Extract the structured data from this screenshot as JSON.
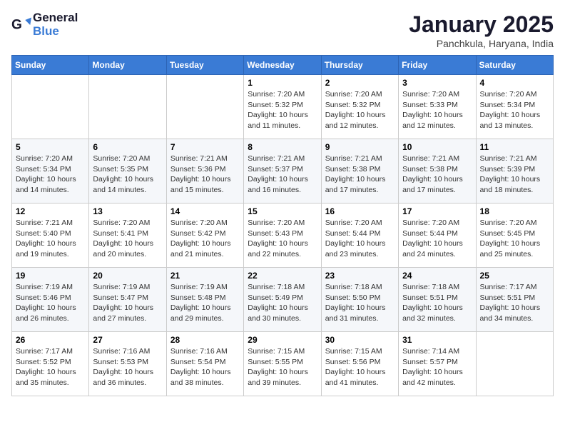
{
  "header": {
    "logo_line1": "General",
    "logo_line2": "Blue",
    "month": "January 2025",
    "location": "Panchkula, Haryana, India"
  },
  "days_of_week": [
    "Sunday",
    "Monday",
    "Tuesday",
    "Wednesday",
    "Thursday",
    "Friday",
    "Saturday"
  ],
  "weeks": [
    [
      {
        "day": "",
        "info": ""
      },
      {
        "day": "",
        "info": ""
      },
      {
        "day": "",
        "info": ""
      },
      {
        "day": "1",
        "info": "Sunrise: 7:20 AM\nSunset: 5:32 PM\nDaylight: 10 hours\nand 11 minutes."
      },
      {
        "day": "2",
        "info": "Sunrise: 7:20 AM\nSunset: 5:32 PM\nDaylight: 10 hours\nand 12 minutes."
      },
      {
        "day": "3",
        "info": "Sunrise: 7:20 AM\nSunset: 5:33 PM\nDaylight: 10 hours\nand 12 minutes."
      },
      {
        "day": "4",
        "info": "Sunrise: 7:20 AM\nSunset: 5:34 PM\nDaylight: 10 hours\nand 13 minutes."
      }
    ],
    [
      {
        "day": "5",
        "info": "Sunrise: 7:20 AM\nSunset: 5:34 PM\nDaylight: 10 hours\nand 14 minutes."
      },
      {
        "day": "6",
        "info": "Sunrise: 7:20 AM\nSunset: 5:35 PM\nDaylight: 10 hours\nand 14 minutes."
      },
      {
        "day": "7",
        "info": "Sunrise: 7:21 AM\nSunset: 5:36 PM\nDaylight: 10 hours\nand 15 minutes."
      },
      {
        "day": "8",
        "info": "Sunrise: 7:21 AM\nSunset: 5:37 PM\nDaylight: 10 hours\nand 16 minutes."
      },
      {
        "day": "9",
        "info": "Sunrise: 7:21 AM\nSunset: 5:38 PM\nDaylight: 10 hours\nand 17 minutes."
      },
      {
        "day": "10",
        "info": "Sunrise: 7:21 AM\nSunset: 5:38 PM\nDaylight: 10 hours\nand 17 minutes."
      },
      {
        "day": "11",
        "info": "Sunrise: 7:21 AM\nSunset: 5:39 PM\nDaylight: 10 hours\nand 18 minutes."
      }
    ],
    [
      {
        "day": "12",
        "info": "Sunrise: 7:21 AM\nSunset: 5:40 PM\nDaylight: 10 hours\nand 19 minutes."
      },
      {
        "day": "13",
        "info": "Sunrise: 7:20 AM\nSunset: 5:41 PM\nDaylight: 10 hours\nand 20 minutes."
      },
      {
        "day": "14",
        "info": "Sunrise: 7:20 AM\nSunset: 5:42 PM\nDaylight: 10 hours\nand 21 minutes."
      },
      {
        "day": "15",
        "info": "Sunrise: 7:20 AM\nSunset: 5:43 PM\nDaylight: 10 hours\nand 22 minutes."
      },
      {
        "day": "16",
        "info": "Sunrise: 7:20 AM\nSunset: 5:44 PM\nDaylight: 10 hours\nand 23 minutes."
      },
      {
        "day": "17",
        "info": "Sunrise: 7:20 AM\nSunset: 5:44 PM\nDaylight: 10 hours\nand 24 minutes."
      },
      {
        "day": "18",
        "info": "Sunrise: 7:20 AM\nSunset: 5:45 PM\nDaylight: 10 hours\nand 25 minutes."
      }
    ],
    [
      {
        "day": "19",
        "info": "Sunrise: 7:19 AM\nSunset: 5:46 PM\nDaylight: 10 hours\nand 26 minutes."
      },
      {
        "day": "20",
        "info": "Sunrise: 7:19 AM\nSunset: 5:47 PM\nDaylight: 10 hours\nand 27 minutes."
      },
      {
        "day": "21",
        "info": "Sunrise: 7:19 AM\nSunset: 5:48 PM\nDaylight: 10 hours\nand 29 minutes."
      },
      {
        "day": "22",
        "info": "Sunrise: 7:18 AM\nSunset: 5:49 PM\nDaylight: 10 hours\nand 30 minutes."
      },
      {
        "day": "23",
        "info": "Sunrise: 7:18 AM\nSunset: 5:50 PM\nDaylight: 10 hours\nand 31 minutes."
      },
      {
        "day": "24",
        "info": "Sunrise: 7:18 AM\nSunset: 5:51 PM\nDaylight: 10 hours\nand 32 minutes."
      },
      {
        "day": "25",
        "info": "Sunrise: 7:17 AM\nSunset: 5:51 PM\nDaylight: 10 hours\nand 34 minutes."
      }
    ],
    [
      {
        "day": "26",
        "info": "Sunrise: 7:17 AM\nSunset: 5:52 PM\nDaylight: 10 hours\nand 35 minutes."
      },
      {
        "day": "27",
        "info": "Sunrise: 7:16 AM\nSunset: 5:53 PM\nDaylight: 10 hours\nand 36 minutes."
      },
      {
        "day": "28",
        "info": "Sunrise: 7:16 AM\nSunset: 5:54 PM\nDaylight: 10 hours\nand 38 minutes."
      },
      {
        "day": "29",
        "info": "Sunrise: 7:15 AM\nSunset: 5:55 PM\nDaylight: 10 hours\nand 39 minutes."
      },
      {
        "day": "30",
        "info": "Sunrise: 7:15 AM\nSunset: 5:56 PM\nDaylight: 10 hours\nand 41 minutes."
      },
      {
        "day": "31",
        "info": "Sunrise: 7:14 AM\nSunset: 5:57 PM\nDaylight: 10 hours\nand 42 minutes."
      },
      {
        "day": "",
        "info": ""
      }
    ]
  ]
}
